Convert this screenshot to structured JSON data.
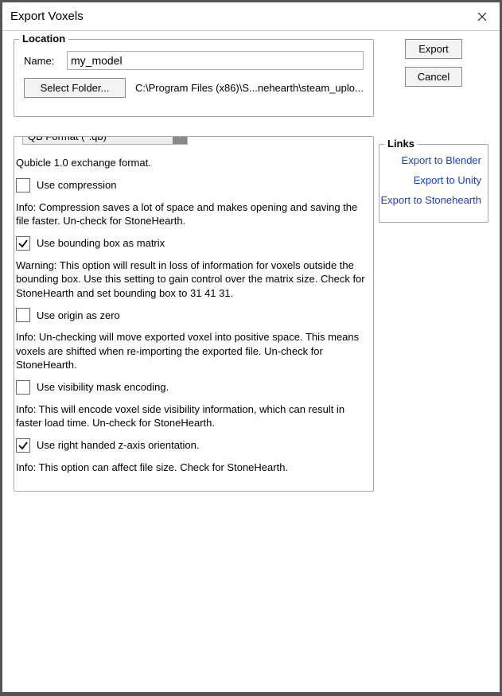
{
  "window": {
    "title": "Export Voxels"
  },
  "sidebar": {
    "export_label": "Export",
    "cancel_label": "Cancel",
    "links_legend": "Links",
    "links": {
      "blender": "Export to Blender",
      "unity": "Export to Unity",
      "stonehearth": "Export to Stonehearth"
    }
  },
  "location": {
    "legend": "Location",
    "name_label": "Name:",
    "name_value": "my_model",
    "folder_button": "Select Folder...",
    "path": "C:\\Program Files (x86)\\S...nehearth\\steam_uplo..."
  },
  "format": {
    "selected": "QB Format (*.qb)",
    "desc": "Qubicle 1.0 exchange format.",
    "use_compression": {
      "label": "Use compression",
      "info": "Info: Compression saves a lot of space and makes opening and saving the file faster. Un-check for StoneHearth.",
      "checked": false
    },
    "use_bounding_box": {
      "label": "Use bounding box as matrix",
      "info": "Warning: This option will result in loss of information for voxels outside the bounding box. Use this setting to gain control over the matrix size. Check for StoneHearth and set bounding box to 31 41 31.",
      "checked": true
    },
    "use_origin_zero": {
      "label": "Use origin as zero",
      "info": "Info: Un-checking will move exported voxel into positive space. This means voxels are shifted when re-importing the exported file. Un-check for StoneHearth.",
      "checked": false
    },
    "use_visibility_mask": {
      "label": "Use visibility mask encoding.",
      "info": "Info: This will encode voxel side visibility information, which can result in faster load time. Un-check for StoneHearth.",
      "checked": false
    },
    "use_right_handed": {
      "label": "Use right handed z-axis orientation.",
      "info": "Info: This option can affect file size. Check for StoneHearth.",
      "checked": true
    }
  }
}
